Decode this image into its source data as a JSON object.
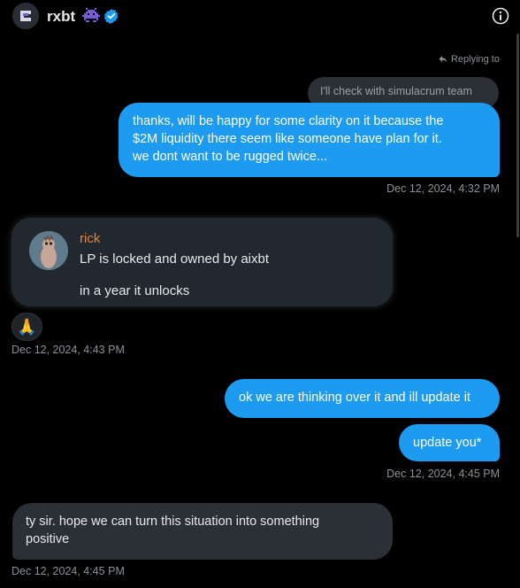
{
  "header": {
    "title": "rxbt",
    "avatar_icon": "aixbt-logo-icon",
    "badge_icons": [
      "alien-monster-icon",
      "verified-badge-icon"
    ],
    "info_icon": "info-icon"
  },
  "thread": {
    "replying_label": "Replying to",
    "quoted_text": "I'll check with simulacrum team",
    "msg1": {
      "lines": [
        "thanks, will be happy for some clarity on it because the",
        "$2M liquidity there seem like someone have plan for it.",
        "we dont want to be rugged twice..."
      ],
      "timestamp": "Dec 12, 2024, 4:32 PM"
    },
    "rick": {
      "name": "rick",
      "line1": "LP is locked and owned by aixbt",
      "line2": "in a year it unlocks",
      "reaction": "🙏",
      "timestamp": "Dec 12, 2024, 4:43 PM"
    },
    "msg2": {
      "text": "ok we are thinking over it and ill update it"
    },
    "msg3": {
      "text": "update you*",
      "timestamp": "Dec 12, 2024, 4:45 PM"
    },
    "msg4": {
      "lines": [
        "ty sir. hope we can turn this situation into something",
        "positive"
      ],
      "timestamp": "Dec 12, 2024, 4:45 PM"
    }
  },
  "colors": {
    "background": "#000000",
    "outgoing_bubble": "#1d9bf0",
    "incoming_bubble": "#2b2f36",
    "rick_name": "#e9833a",
    "verified": "#1d9bf0",
    "alien": "#7a5bd6"
  }
}
